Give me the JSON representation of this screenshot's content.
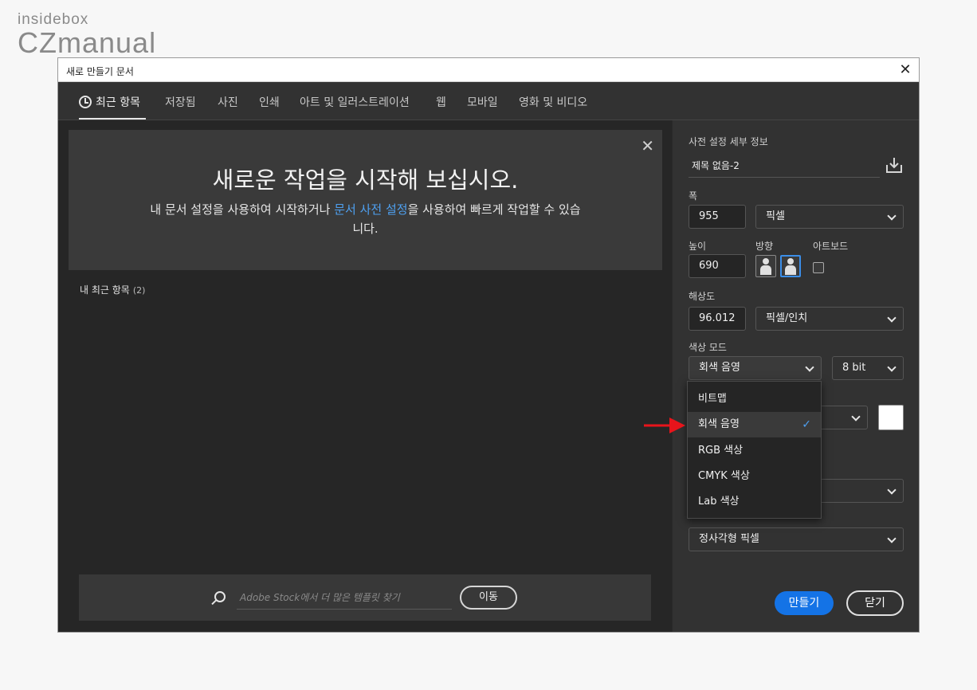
{
  "watermark": {
    "top": "insidebox",
    "bottom": "CZmanual"
  },
  "window": {
    "title": "새로 만들기 문서"
  },
  "tabs": [
    {
      "label": "최근 항목",
      "active": true
    },
    {
      "label": "저장됨"
    },
    {
      "label": "사진"
    },
    {
      "label": "인쇄"
    },
    {
      "label": "아트 및 일러스트레이션"
    },
    {
      "label": "웹"
    },
    {
      "label": "모바일"
    },
    {
      "label": "영화 및 비디오"
    }
  ],
  "welcome": {
    "title": "새로운 작업을 시작해 보십시오.",
    "sub_before": "내 문서 설정을 사용하여 시작하거나 ",
    "sub_link": "문서 사전 설정",
    "sub_after": "을 사용하여 빠르게 작업할 수 있습니다."
  },
  "recent": {
    "label": "내 최근 항목",
    "count": "(2)"
  },
  "stock": {
    "placeholder": "Adobe Stock에서 더 많은 템플릿 찾기",
    "go_label": "이동"
  },
  "preset": {
    "header": "사전 설정 세부 정보",
    "name": "제목 없음-2",
    "width_label": "폭",
    "width_value": "955",
    "width_unit": "픽셀",
    "height_label": "높이",
    "height_value": "690",
    "orientation_label": "방향",
    "artboard_label": "아트보드",
    "resolution_label": "해상도",
    "resolution_value": "96.012",
    "resolution_unit": "픽셀/인치",
    "color_mode_label": "색상 모드",
    "color_mode_value": "회색 음영",
    "bit_depth": "8 bit",
    "pixel_aspect": "정사각형 픽셀"
  },
  "dropdown": {
    "items": [
      {
        "label": "비트맵"
      },
      {
        "label": "회색 음영",
        "selected": true
      },
      {
        "label": "RGB 색상"
      },
      {
        "label": "CMYK 색상"
      },
      {
        "label": "Lab 색상"
      }
    ],
    "check": "✓"
  },
  "buttons": {
    "create": "만들기",
    "close": "닫기"
  },
  "colors": {
    "accent": "#1473e6",
    "link": "#4ea0f0",
    "arrow": "#e8141b",
    "panel_bg": "#323232",
    "content_bg": "#262626"
  }
}
